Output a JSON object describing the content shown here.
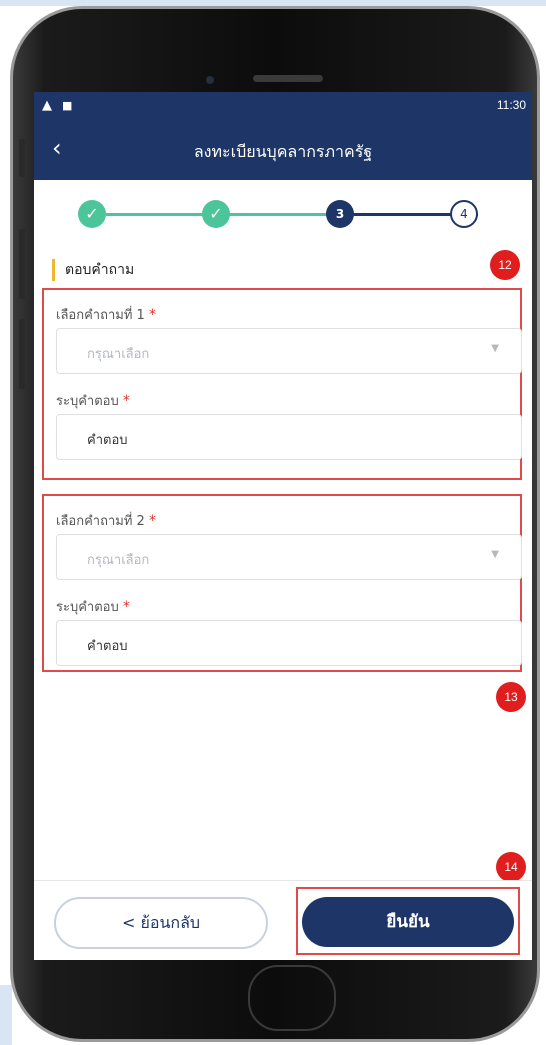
{
  "status_bar": {
    "time": "11:30",
    "icons": [
      "warning-icon",
      "notification-icon"
    ]
  },
  "app_bar": {
    "title": "ลงทะเบียนบุคลากรภาครัฐ",
    "back_icon": "chevron-left-icon"
  },
  "stepper": {
    "steps": [
      {
        "label": "✓",
        "state": "done"
      },
      {
        "label": "✓",
        "state": "done"
      },
      {
        "label": "3",
        "state": "active"
      },
      {
        "label": "4",
        "state": "todo"
      }
    ]
  },
  "section": {
    "title": "ตอบคำถาม"
  },
  "questions": [
    {
      "select_label": "เลือกคำถามที่ 1",
      "select_placeholder": "กรุณาเลือก",
      "answer_label": "ระบุคำตอบ",
      "answer_value": "คำตอบ"
    },
    {
      "select_label": "เลือกคำถามที่ 2",
      "select_placeholder": "กรุณาเลือก",
      "answer_label": "ระบุคำตอบ",
      "answer_value": "คำตอบ"
    }
  ],
  "required_mark": "*",
  "badges": [
    "12",
    "13",
    "14"
  ],
  "buttons": {
    "back_label": "< ย้อนกลับ",
    "confirm_label": "ยืนยัน"
  },
  "colors": {
    "primary": "#1e3567",
    "success": "#4cc59a",
    "highlight": "#e24a4a",
    "badge": "#e01e1e",
    "accent_bar": "#f2b531"
  }
}
